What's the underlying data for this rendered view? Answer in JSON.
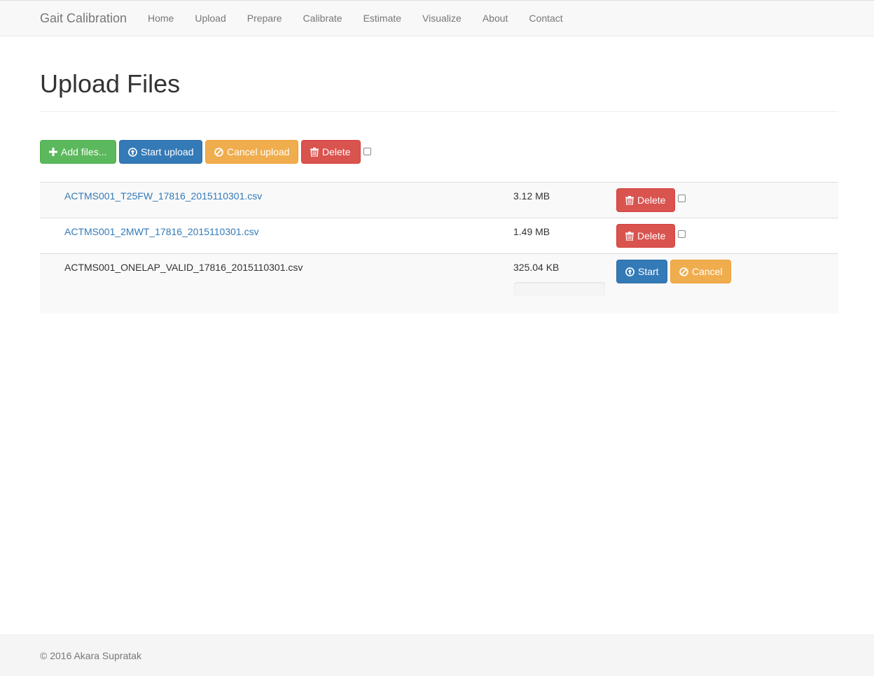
{
  "navbar": {
    "brand": "Gait Calibration",
    "items": [
      {
        "label": "Home"
      },
      {
        "label": "Upload"
      },
      {
        "label": "Prepare"
      },
      {
        "label": "Calibrate"
      },
      {
        "label": "Estimate"
      },
      {
        "label": "Visualize"
      },
      {
        "label": "About"
      },
      {
        "label": "Contact"
      }
    ]
  },
  "page": {
    "title": "Upload Files"
  },
  "toolbar": {
    "add_files": "Add files...",
    "start_upload": "Start upload",
    "cancel_upload": "Cancel upload",
    "delete": "Delete"
  },
  "files": [
    {
      "name": "ACTMS001_T25FW_17816_2015110301.csv",
      "size": "3.12 MB",
      "status": "uploaded",
      "delete_label": "Delete"
    },
    {
      "name": "ACTMS001_2MWT_17816_2015110301.csv",
      "size": "1.49 MB",
      "status": "uploaded",
      "delete_label": "Delete"
    },
    {
      "name": "ACTMS001_ONELAP_VALID_17816_2015110301.csv",
      "size": "325.04 KB",
      "status": "pending",
      "progress": 0,
      "start_label": "Start",
      "cancel_label": "Cancel"
    }
  ],
  "footer": {
    "text": "© 2016 Akara Supratak"
  },
  "colors": {
    "success": "#5cb85c",
    "primary": "#337ab7",
    "warning": "#f0ad4e",
    "danger": "#d9534f",
    "link": "#337ab7"
  },
  "icons": {
    "add": "plus-icon",
    "upload": "circle-arrow-up-icon",
    "cancel": "ban-circle-icon",
    "delete": "trash-icon"
  }
}
